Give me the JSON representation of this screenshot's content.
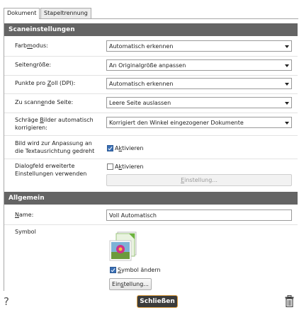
{
  "tabs": [
    "Dokument",
    "Stapeltrennung"
  ],
  "sections": {
    "scan": "Scaneinstellungen",
    "general": "Allgemein"
  },
  "scan": {
    "color_mode": {
      "label": "Farbmodus:",
      "value": "Automatisch erkennen"
    },
    "page_size": {
      "label": "Seitengröße:",
      "value": "An Originalgröße anpassen"
    },
    "dpi": {
      "label": "Punkte pro Zoll (DPI):",
      "value": "Automatisch erkennen"
    },
    "side": {
      "label": "Zu scannende Seite:",
      "value": "Leere Seite auslassen"
    },
    "deskew": {
      "label_line1": "Schräge Bilder automatisch",
      "label_line2": "korrigieren:",
      "value": "Korrigiert den Winkel eingezogener Dokumente"
    },
    "rotate": {
      "label_line1": "Bild wird zur Anpassung an",
      "label_line2": "die Textausrichtung gedreht",
      "checkbox_label": "Aktivieren",
      "checked": true
    },
    "advanced": {
      "label_line1": "Dialogfeld erweiterte",
      "label_line2": "Einstellungen verwenden",
      "checkbox_label": "Aktivieren",
      "checked": false,
      "button": "Einstellung..."
    }
  },
  "general": {
    "name": {
      "label": "Name:",
      "value": "Voll Automatisch"
    },
    "symbol": {
      "label": "Symbol",
      "change_label": "Symbol ändern",
      "checked": true,
      "button": "Einstellung..."
    }
  },
  "footer": {
    "help": "?",
    "close": "Schließen",
    "trash_icon": "trash-icon"
  }
}
